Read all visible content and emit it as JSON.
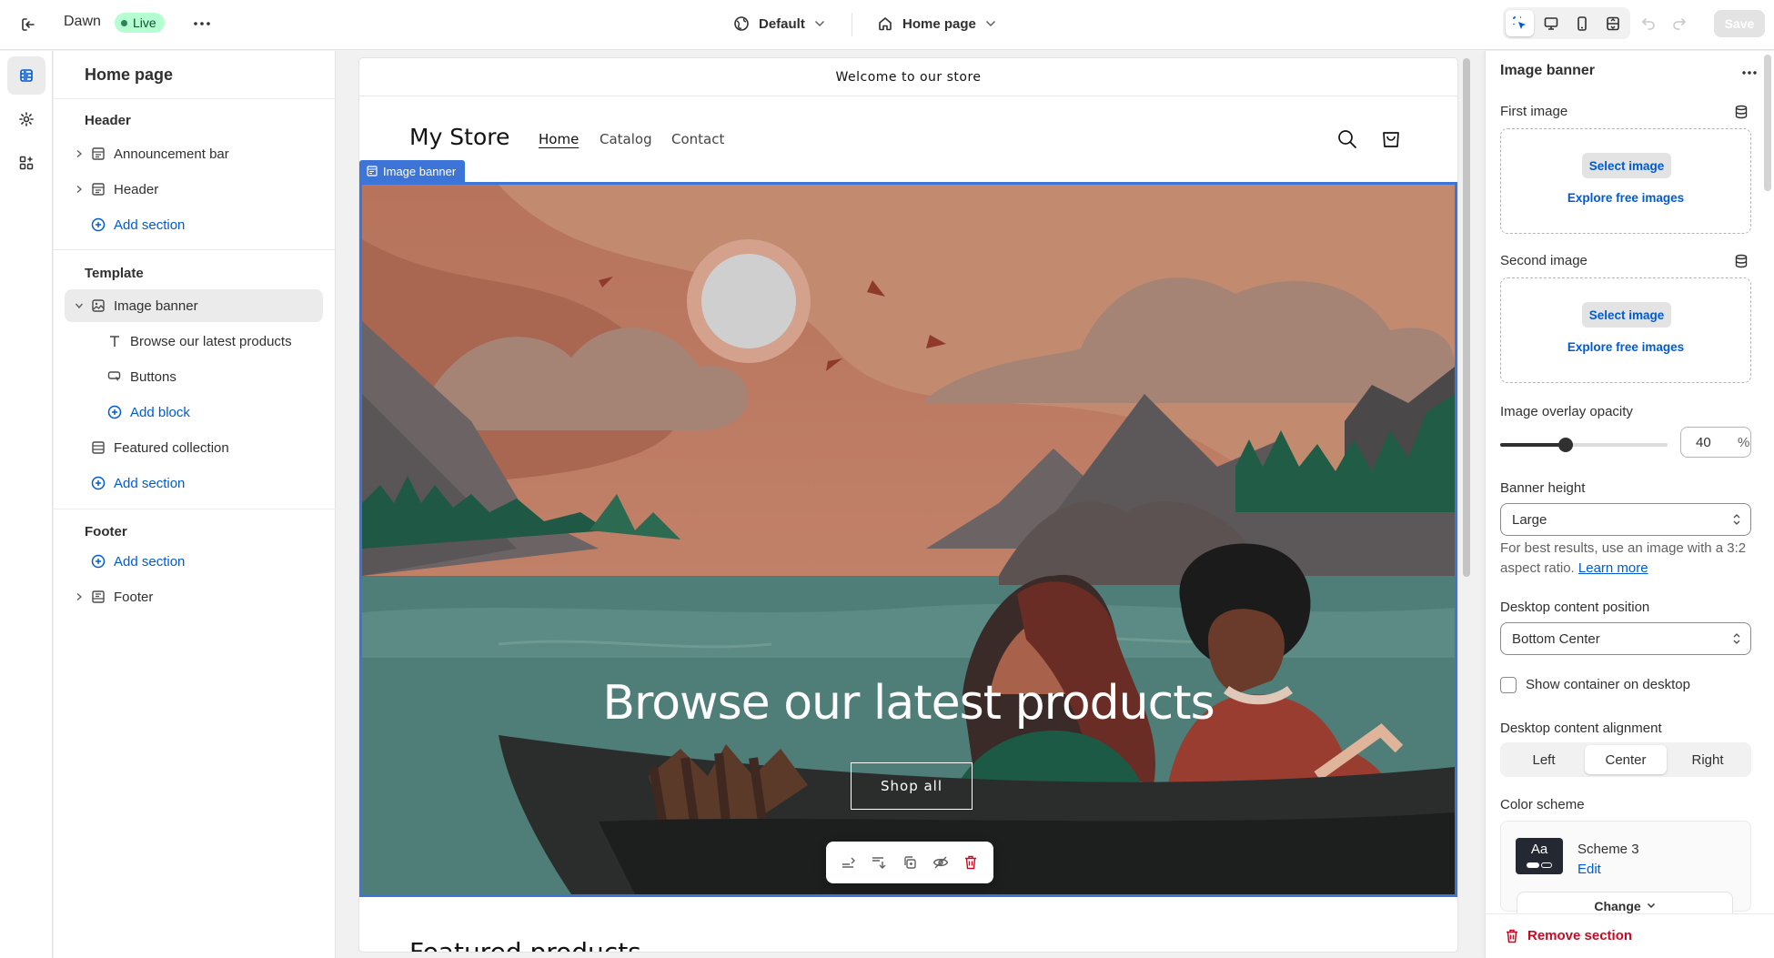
{
  "topbar": {
    "theme_name": "Dawn",
    "live_badge": "Live",
    "template_label": "Default",
    "page_label": "Home page",
    "save_label": "Save"
  },
  "sections_panel": {
    "title": "Home page",
    "groups": {
      "header": {
        "title": "Header",
        "items": [
          "Announcement bar",
          "Header"
        ],
        "add_label": "Add section"
      },
      "template": {
        "title": "Template",
        "selected": "Image banner",
        "blocks": [
          "Browse our latest products",
          "Buttons"
        ],
        "add_block_label": "Add block",
        "other": "Featured collection",
        "add_label": "Add section"
      },
      "footer": {
        "title": "Footer",
        "add_label": "Add section",
        "items": [
          "Footer"
        ]
      }
    }
  },
  "preview": {
    "announcement": "Welcome to our store",
    "store_name": "My Store",
    "nav": [
      "Home",
      "Catalog",
      "Contact"
    ],
    "banner_tag": "Image banner",
    "banner_heading": "Browse our latest products",
    "banner_button": "Shop all",
    "next_section_heading": "Featured products"
  },
  "settings": {
    "title": "Image banner",
    "first_image_label": "First image",
    "second_image_label": "Second image",
    "select_image": "Select image",
    "explore_images": "Explore free images",
    "overlay_label": "Image overlay opacity",
    "overlay_value": "40",
    "overlay_unit": "%",
    "banner_height_label": "Banner height",
    "banner_height_value": "Large",
    "help_text": "For best results, use an image with a 3:2 aspect ratio.",
    "help_link": "Learn more",
    "desktop_position_label": "Desktop content position",
    "desktop_position_value": "Bottom Center",
    "show_container_label": "Show container on desktop",
    "alignment_label": "Desktop content alignment",
    "alignment_options": [
      "Left",
      "Center",
      "Right"
    ],
    "alignment_selected": "Center",
    "color_scheme_label": "Color scheme",
    "scheme_swatch_text": "Aa",
    "scheme_name": "Scheme 3",
    "scheme_edit": "Edit",
    "change_label": "Change",
    "remove_label": "Remove section"
  },
  "colors": {
    "accent_blue": "#005bd3",
    "selection_blue": "#3c74d8",
    "live_green": "#b4fed2",
    "danger_red": "#c70a24"
  }
}
